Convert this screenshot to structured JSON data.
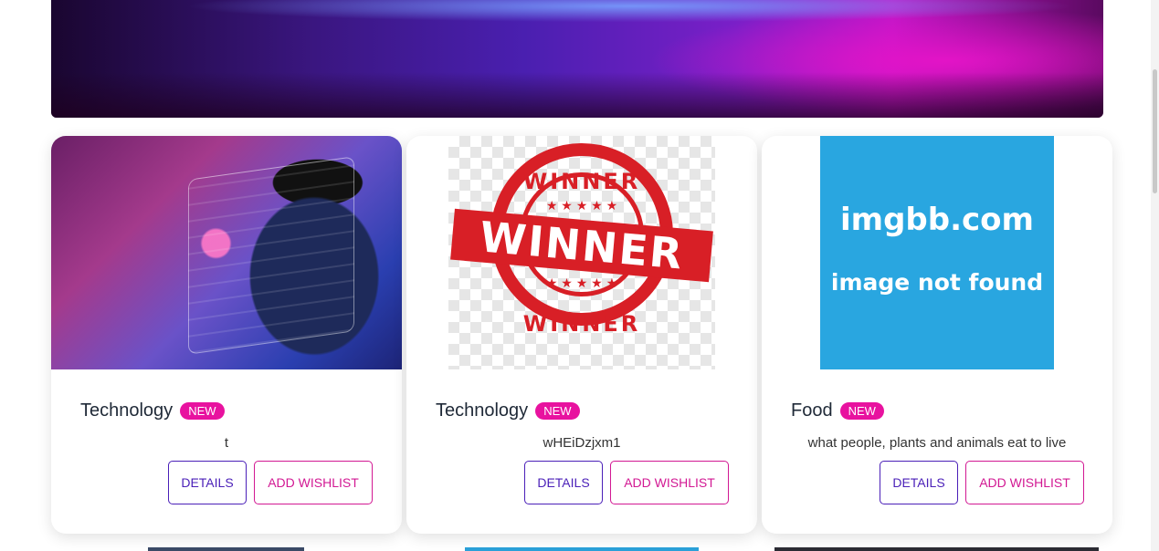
{
  "cards": [
    {
      "category": "Technology",
      "badge": "NEW",
      "description": "t",
      "details_label": "Details",
      "wishlist_label": "Add Wishlist"
    },
    {
      "category": "Technology",
      "badge": "NEW",
      "description": "wHEiDzjxm1",
      "details_label": "Details",
      "wishlist_label": "Add Wishlist",
      "image_text": {
        "top": "WINNER",
        "ribbon": "WINNER",
        "bottom": "WINNER",
        "stars": "★ ★ ★ ★ ★"
      }
    },
    {
      "category": "Food",
      "badge": "NEW",
      "description": "what people, plants and animals eat to live",
      "details_label": "Details",
      "wishlist_label": "Add Wishlist",
      "image_text": {
        "line1": "imgbb.com",
        "line2": "image not found"
      }
    }
  ],
  "colors": {
    "badge": "#e8129f",
    "details_border": "#4a1fb8",
    "wishlist_border": "#d21893"
  }
}
